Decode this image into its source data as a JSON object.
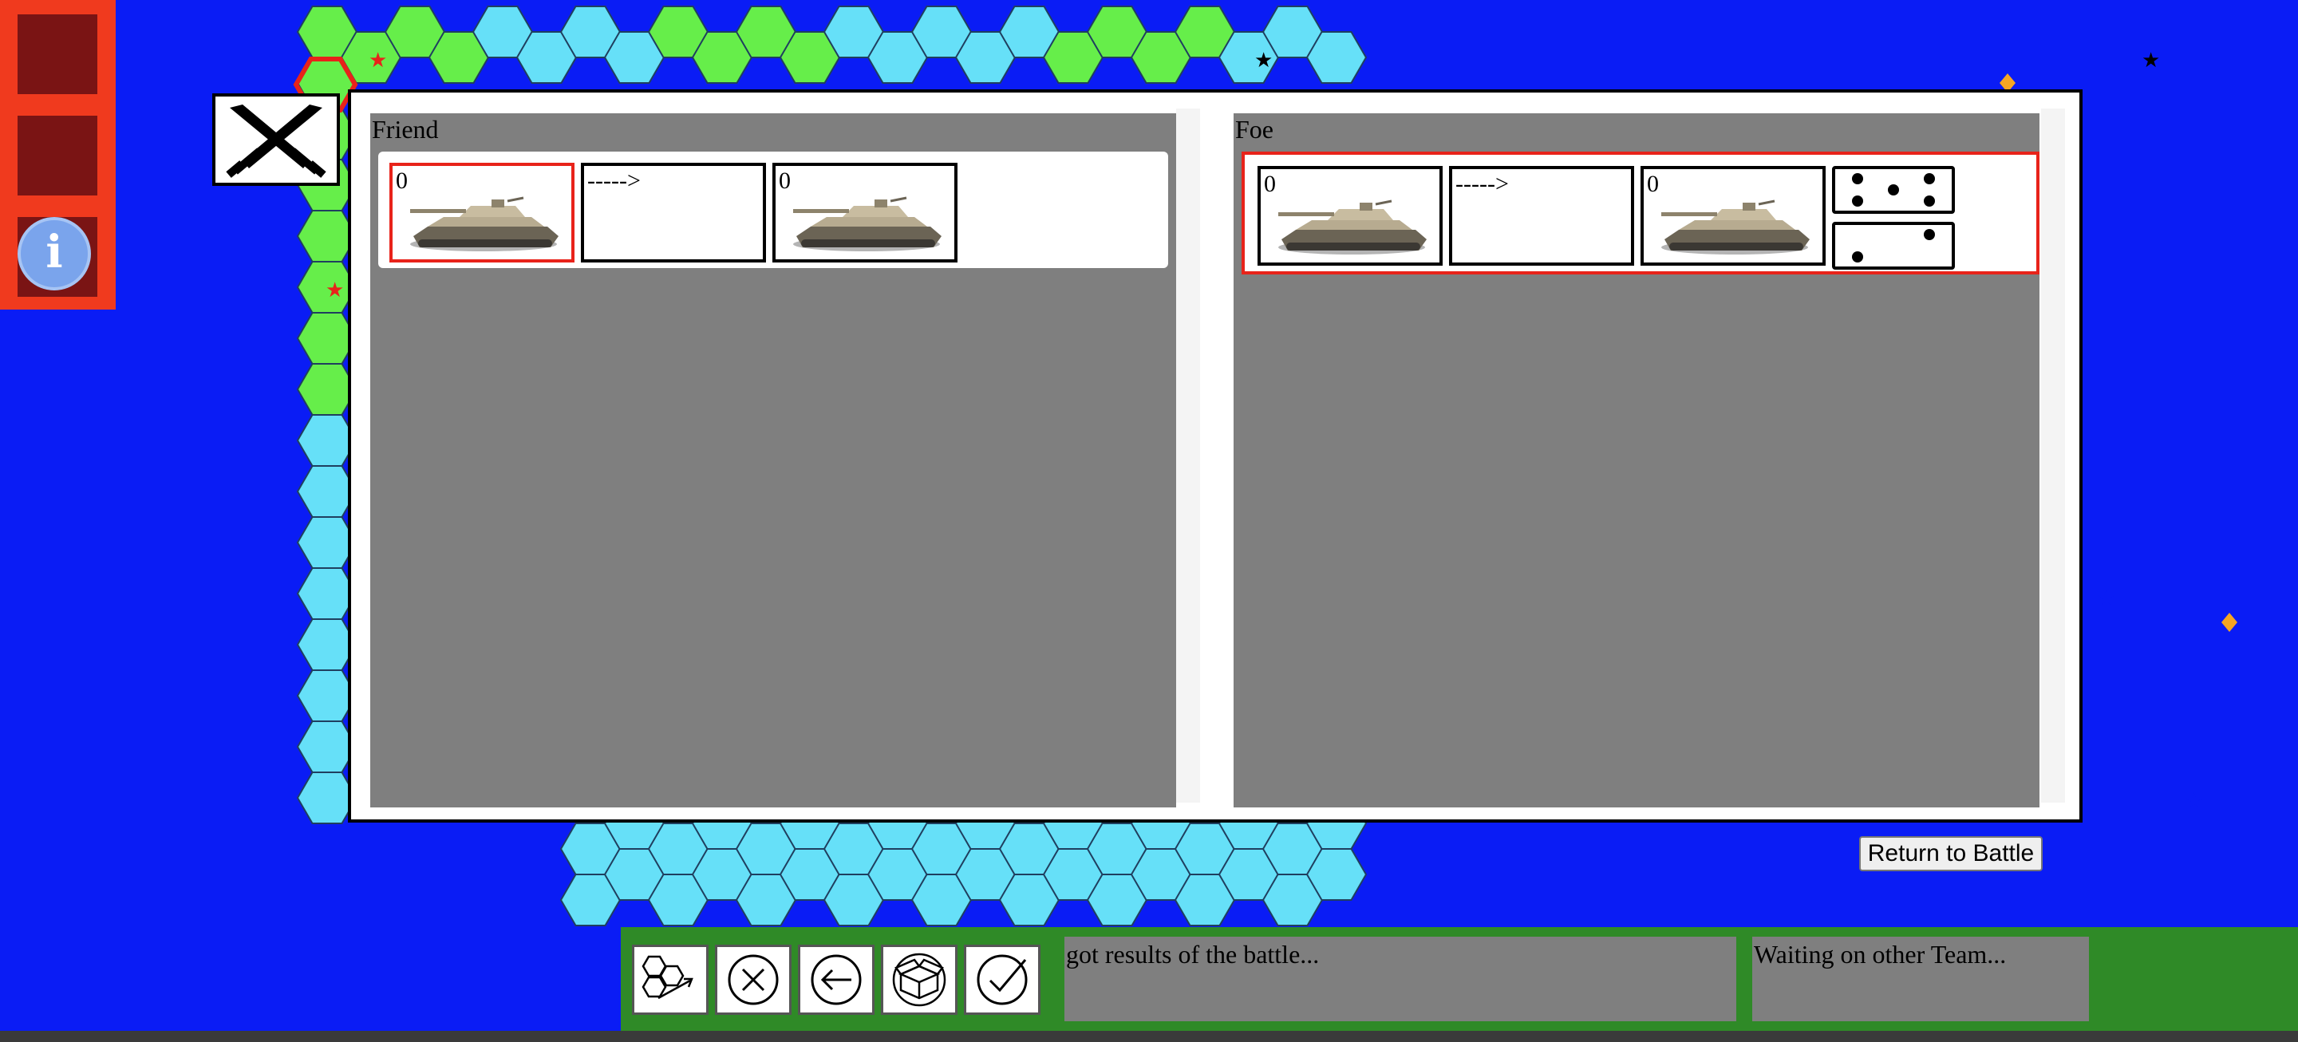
{
  "side_panel": {
    "info_label": "i"
  },
  "battle_dialog": {
    "friend": {
      "title": "Friend",
      "before_count": "0",
      "arrow": "----->",
      "after_count": "0"
    },
    "foe": {
      "title": "Foe",
      "before_count": "0",
      "arrow": "----->",
      "after_count": "0",
      "dice": [
        5,
        2
      ]
    }
  },
  "return_button": "Return to Battle",
  "bottom_bar": {
    "tools": [
      "move-hex-icon",
      "cancel-icon",
      "back-arrow-icon",
      "supply-box-icon",
      "confirm-check-icon"
    ],
    "message_left": "got results of the battle...",
    "message_right": "Waiting on other Team..."
  },
  "colors": {
    "sea": "#0a1cf5",
    "water_hex": "#66e0f8",
    "land_hex": "#66ee4a",
    "panel_red": "#f03a1e",
    "bar_green": "#2f8a27",
    "highlight_red": "#e8231a"
  }
}
